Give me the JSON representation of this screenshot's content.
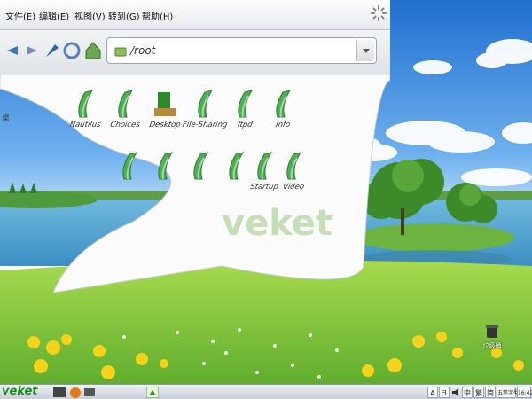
{
  "menubar": {
    "items": [
      "文件(E)",
      "编辑(E)",
      "视图(V)",
      "转到(G)",
      "帮助(H)"
    ]
  },
  "address": {
    "path": "/root"
  },
  "folders_row1": [
    {
      "label": "Nautilus",
      "icon": "folder-icon"
    },
    {
      "label": "Choices",
      "icon": "folder-icon"
    },
    {
      "label": "Desktop",
      "icon": "desktop-folder-icon"
    },
    {
      "label": "File-Sharing",
      "icon": "folder-icon"
    },
    {
      "label": "ftpd",
      "icon": "folder-icon"
    },
    {
      "label": "Info",
      "icon": "folder-icon"
    }
  ],
  "folders_row2": [
    {
      "label": "",
      "icon": "folder-icon"
    },
    {
      "label": "",
      "icon": "folder-icon"
    },
    {
      "label": "",
      "icon": "folder-icon"
    },
    {
      "label": "",
      "icon": "folder-icon"
    },
    {
      "label": "Startup",
      "icon": "folder-icon"
    },
    {
      "label": "Video",
      "icon": "folder-icon"
    }
  ],
  "watermark": "veket",
  "desktop_icon": {
    "label": "垃圾桶",
    "icon": "trash-icon"
  },
  "taskbar": {
    "logo": "veket",
    "tray": [
      "A",
      "ᖷ",
      "中",
      "繁",
      "简",
      "五笔字型"
    ],
    "clock": "16:42"
  },
  "colors": {
    "accent_green": "#2e9e2e",
    "sky": "#2f7fd6",
    "grass": "#7cc83a"
  }
}
